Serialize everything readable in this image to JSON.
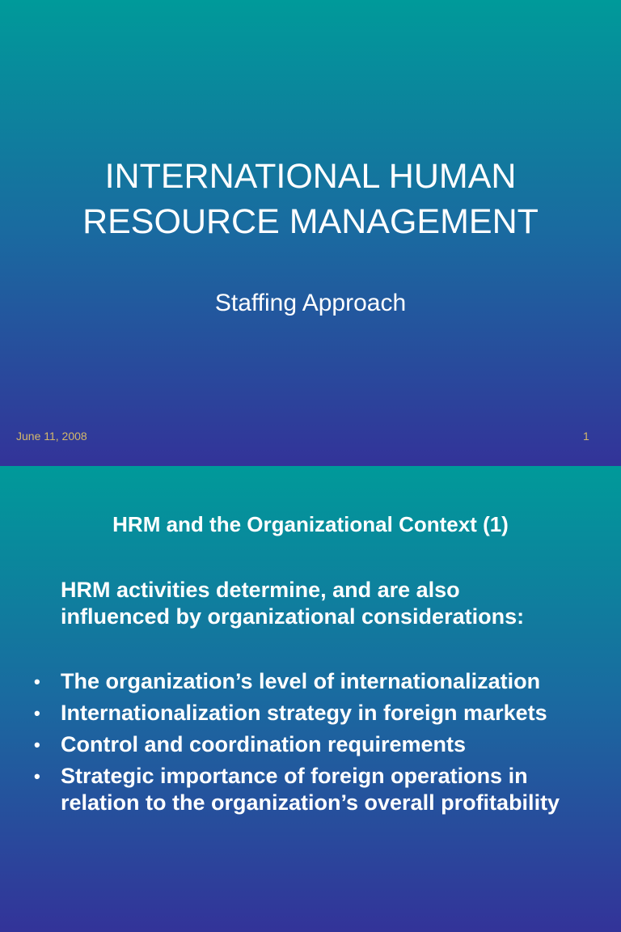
{
  "slide1": {
    "title_lines": [
      "INTERNATIONAL HUMAN",
      "RESOURCE MANAGEMENT"
    ],
    "subtitle": "Staffing Approach",
    "date": "June 11, 2008",
    "page_number": "1"
  },
  "slide2": {
    "title": "HRM and the Organizational Context (1)",
    "intro_lines": [
      "HRM activities determine, and are also",
      "influenced by organizational considerations:"
    ],
    "bullet_icon": "•",
    "bullets": [
      "The organization’s level of internationalization",
      "Internationalization strategy in foreign markets",
      "Control and coordination requirements",
      "Strategic importance of foreign operations in relation to the organization’s overall profitability"
    ]
  }
}
